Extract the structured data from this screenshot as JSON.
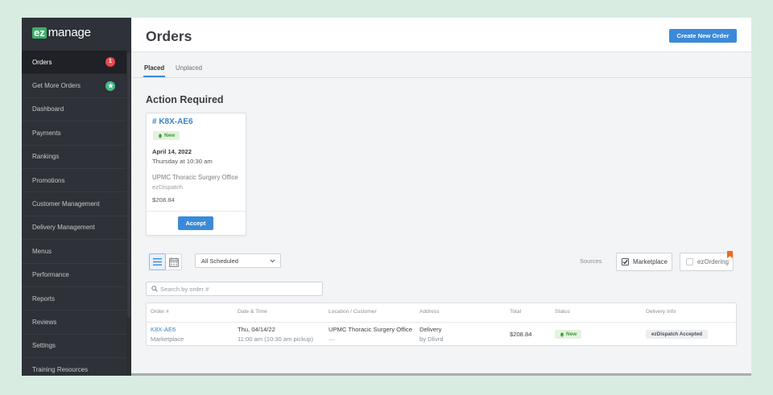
{
  "colors": {
    "page_bg": "#d8ece1",
    "sidebar_bg": "#2e3137",
    "sidebar_active_bg": "#1f2126",
    "accent_blue": "#3b8ad9",
    "link_blue": "#3a84c6",
    "badge_red": "#e5484d",
    "badge_green": "#48b98a",
    "status_new_bg": "#e3f3de",
    "status_new_text": "#3c9a38",
    "ribbon_orange": "#f0691e",
    "logo_green": "#3fae6b"
  },
  "logo": {
    "prefix": "ez",
    "suffix": "manage"
  },
  "sidebar": {
    "items": [
      {
        "label": "Orders",
        "active": true,
        "badge": "1"
      },
      {
        "label": "Get More Orders",
        "active": false,
        "badge_icon": "star-icon"
      },
      {
        "label": "Dashboard",
        "active": false
      },
      {
        "label": "Payments",
        "active": false
      },
      {
        "label": "Rankings",
        "active": false
      },
      {
        "label": "Promotions",
        "active": false
      },
      {
        "label": "Customer Management",
        "active": false
      },
      {
        "label": "Delivery Management",
        "active": false
      },
      {
        "label": "Menus",
        "active": false
      },
      {
        "label": "Performance",
        "active": false
      },
      {
        "label": "Reports",
        "active": false
      },
      {
        "label": "Reviews",
        "active": false
      },
      {
        "label": "Settings",
        "active": false
      },
      {
        "label": "Training Resources",
        "active": false
      }
    ]
  },
  "header": {
    "title": "Orders",
    "create_button": "Create New Order"
  },
  "tabs": [
    {
      "label": "Placed",
      "active": true
    },
    {
      "label": "Unplaced",
      "active": false
    }
  ],
  "action_required": {
    "heading": "Action Required",
    "card": {
      "order_id": "# K8X-AE6",
      "status": "New",
      "status_icon": "bell-icon",
      "date": "April 14, 2022",
      "time": "Thursday at 10:30 am",
      "location": "UPMC Thoracic Surgery Office",
      "source": "ezDispatch",
      "total": "$208.84",
      "accept_button": "Accept"
    }
  },
  "toolbar": {
    "view_modes": [
      {
        "icon": "list-icon",
        "active": true
      },
      {
        "icon": "calendar-icon",
        "active": false
      }
    ],
    "schedule_filter": {
      "selected": "All Scheduled",
      "icon": "chevron-down-icon"
    },
    "sources_label": "Sources",
    "sources": [
      {
        "label": "Marketplace",
        "checked": true
      },
      {
        "label": "ezOrdering",
        "checked": false,
        "flag_icon": "bookmark-icon"
      }
    ]
  },
  "search": {
    "placeholder": "Search by order #",
    "value": "",
    "icon": "search-icon"
  },
  "table": {
    "columns": [
      "Order #",
      "Date & Time",
      "Location / Customer",
      "Address",
      "Total",
      "Status",
      "Delivery Info"
    ],
    "rows": [
      {
        "order_id": "K8X-AE6",
        "source": "Marketplace",
        "date": "Thu, 04/14/22",
        "time": "11:00 am (10:30 am pickup)",
        "location": "UPMC Thoracic Surgery Office",
        "customer": "—",
        "address": "Delivery",
        "address_detail": "by Dlivrd",
        "total": "$208.84",
        "status": "New",
        "delivery_info": "ezDispatch Accepted"
      }
    ]
  }
}
